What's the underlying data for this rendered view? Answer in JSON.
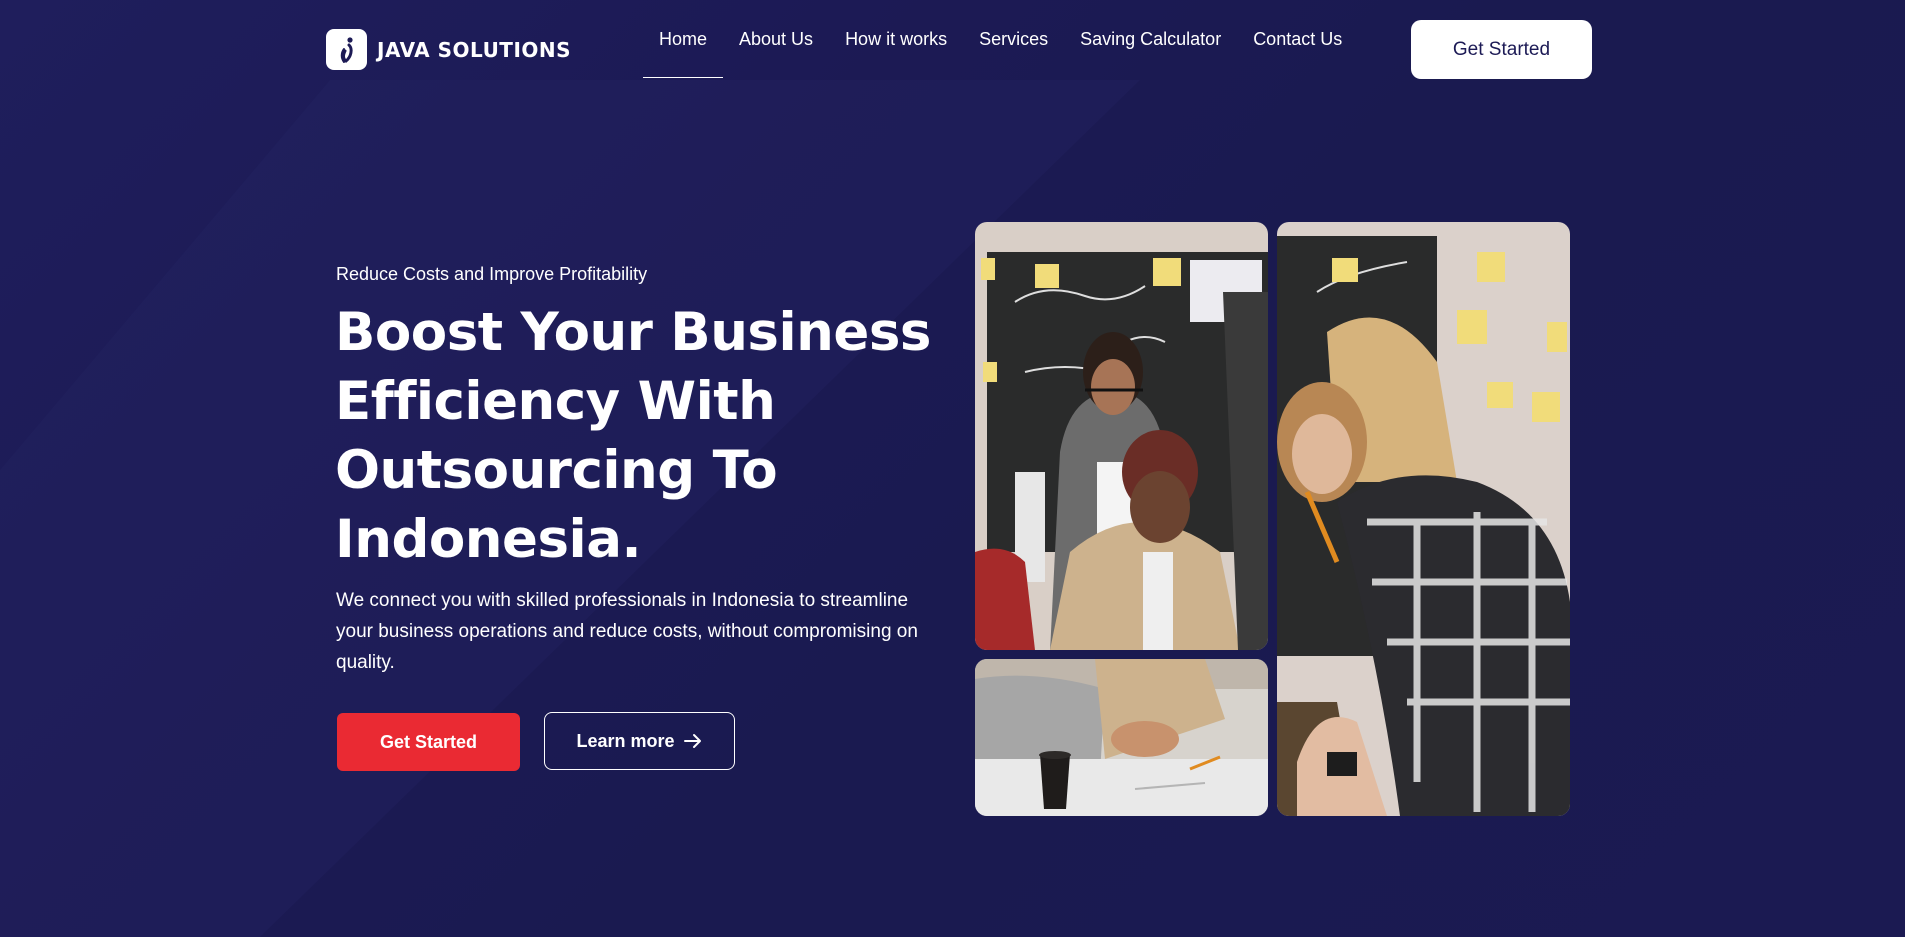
{
  "brand": {
    "name": "JAVA SOLUTIONS",
    "logo_icon": "java-logo-icon"
  },
  "nav": {
    "items": [
      {
        "label": "Home",
        "active": true
      },
      {
        "label": "About Us",
        "active": false
      },
      {
        "label": "How it works",
        "active": false
      },
      {
        "label": "Services",
        "active": false
      },
      {
        "label": "Saving Calculator",
        "active": false
      },
      {
        "label": "Contact Us",
        "active": false
      }
    ],
    "cta_label": "Get Started"
  },
  "hero": {
    "eyebrow": "Reduce Costs and Improve Profitability",
    "headline_lines": [
      "Boost Your Business",
      "Efficiency With",
      "Outsourcing To",
      "Indonesia."
    ],
    "description": "We connect you with skilled professionals in Indonesia to streamline your business operations and reduce costs, without compromising on quality.",
    "primary_button": "Get Started",
    "secondary_button": "Learn more",
    "secondary_icon": "arrow-right-icon"
  },
  "colors": {
    "background": "#1c1a55",
    "accent_red": "#ea2a33",
    "white": "#ffffff"
  }
}
